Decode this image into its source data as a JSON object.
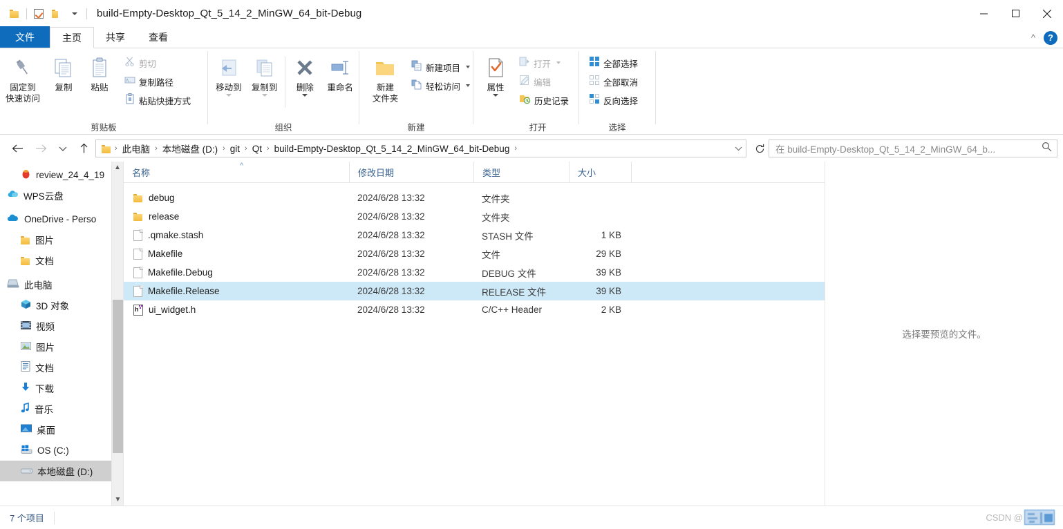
{
  "window": {
    "title": "build-Empty-Desktop_Qt_5_14_2_MinGW_64_bit-Debug",
    "qat": {
      "folder_icon": "folder-icon",
      "properties_icon": "checkbox-properties-icon",
      "new_folder_icon": "new-folder-icon",
      "customize_icon": "chevron-down-icon"
    },
    "controls": {
      "minimize": "minimize-icon",
      "maximize": "maximize-icon",
      "close": "close-icon"
    }
  },
  "tabs": {
    "file": "文件",
    "items": [
      {
        "label": "主页",
        "active": true
      },
      {
        "label": "共享",
        "active": false
      },
      {
        "label": "查看",
        "active": false
      }
    ],
    "collapse_icon": "chevron-up-icon",
    "help_label": "?"
  },
  "ribbon": {
    "groups": [
      {
        "name": "clipboard",
        "label": "剪贴板",
        "big": [
          {
            "label_line1": "固定到",
            "label_line2": "快速访问",
            "icon": "pin-icon",
            "dim": false
          },
          {
            "label_line1": "复制",
            "label_line2": "",
            "icon": "copy-icon",
            "dim": false
          },
          {
            "label_line1": "粘贴",
            "label_line2": "",
            "icon": "paste-icon",
            "dim": false
          }
        ],
        "small": [
          {
            "label": "剪切",
            "icon": "scissors-icon",
            "dim": true
          },
          {
            "label": "复制路径",
            "icon": "copy-path-icon",
            "dim": false
          },
          {
            "label": "粘贴快捷方式",
            "icon": "paste-shortcut-icon",
            "dim": false
          }
        ]
      },
      {
        "name": "organize",
        "label": "组织",
        "big": [
          {
            "label_line1": "移动到",
            "label_line2": "",
            "icon": "move-to-icon",
            "dim": true,
            "caret": true
          },
          {
            "label_line1": "复制到",
            "label_line2": "",
            "icon": "copy-to-icon",
            "dim": true,
            "caret": true
          },
          {
            "label_line1": "删除",
            "label_line2": "",
            "icon": "delete-icon",
            "dim": false,
            "caret": true
          },
          {
            "label_line1": "重命名",
            "label_line2": "",
            "icon": "rename-icon",
            "dim": false
          }
        ],
        "small": []
      },
      {
        "name": "new",
        "label": "新建",
        "big": [
          {
            "label_line1": "新建",
            "label_line2": "文件夹",
            "icon": "new-folder-icon",
            "dim": false
          }
        ],
        "small": [
          {
            "label": "新建项目",
            "icon": "new-item-icon",
            "dim": false,
            "caret": true
          },
          {
            "label": "轻松访问",
            "icon": "easy-access-icon",
            "dim": false,
            "caret": true
          }
        ]
      },
      {
        "name": "open",
        "label": "打开",
        "big": [
          {
            "label_line1": "属性",
            "label_line2": "",
            "icon": "properties-icon",
            "dim": false,
            "caret": true
          }
        ],
        "small": [
          {
            "label": "打开",
            "icon": "open-icon",
            "dim": true,
            "caret": true
          },
          {
            "label": "编辑",
            "icon": "edit-icon",
            "dim": true
          },
          {
            "label": "历史记录",
            "icon": "history-icon",
            "dim": false
          }
        ]
      },
      {
        "name": "select",
        "label": "选择",
        "big": [],
        "small": [
          {
            "label": "全部选择",
            "icon": "select-all-icon",
            "dim": false
          },
          {
            "label": "全部取消",
            "icon": "select-none-icon",
            "dim": false
          },
          {
            "label": "反向选择",
            "icon": "invert-selection-icon",
            "dim": false
          }
        ]
      }
    ]
  },
  "address": {
    "back_icon": "back-arrow-icon",
    "forward_icon": "forward-arrow-icon",
    "recent_icon": "chevron-down-icon",
    "up_icon": "up-arrow-icon",
    "breadcrumbs": [
      "此电脑",
      "本地磁盘 (D:)",
      "git",
      "Qt",
      "build-Empty-Desktop_Qt_5_14_2_MinGW_64_bit-Debug"
    ],
    "dropdown_icon": "chevron-down-icon",
    "refresh_icon": "refresh-icon",
    "search_placeholder": "在 build-Empty-Desktop_Qt_5_14_2_MinGW_64_b...",
    "search_value": "",
    "search_icon": "search-icon"
  },
  "navpane": {
    "items": [
      {
        "label": "review_24_4_19",
        "icon": "recent-red-icon",
        "indent": 1,
        "selected": false
      },
      {
        "label": "WPS云盘",
        "icon": "wps-cloud-icon",
        "indent": 0,
        "selected": false
      },
      {
        "label": "OneDrive - Perso",
        "icon": "onedrive-icon",
        "indent": 0,
        "selected": false
      },
      {
        "label": "图片",
        "icon": "folder-icon",
        "indent": 1,
        "selected": false
      },
      {
        "label": "文档",
        "icon": "folder-icon",
        "indent": 1,
        "selected": false
      },
      {
        "label": "此电脑",
        "icon": "this-pc-icon",
        "indent": 0,
        "selected": false
      },
      {
        "label": "3D 对象",
        "icon": "3d-objects-icon",
        "indent": 1,
        "selected": false
      },
      {
        "label": "视频",
        "icon": "videos-icon",
        "indent": 1,
        "selected": false
      },
      {
        "label": "图片",
        "icon": "pictures-icon",
        "indent": 1,
        "selected": false
      },
      {
        "label": "文档",
        "icon": "documents-icon",
        "indent": 1,
        "selected": false
      },
      {
        "label": "下载",
        "icon": "downloads-icon",
        "indent": 1,
        "selected": false
      },
      {
        "label": "音乐",
        "icon": "music-icon",
        "indent": 1,
        "selected": false
      },
      {
        "label": "桌面",
        "icon": "desktop-icon",
        "indent": 1,
        "selected": false
      },
      {
        "label": "OS (C:)",
        "icon": "windows-drive-icon",
        "indent": 1,
        "selected": false
      },
      {
        "label": "本地磁盘 (D:)",
        "icon": "drive-icon",
        "indent": 1,
        "selected": true
      }
    ],
    "scroll_up_icon": "chevron-up-icon",
    "scroll_down_icon": "chevron-down-icon"
  },
  "filelist": {
    "columns": [
      {
        "label": "名称",
        "sorted": true,
        "sort_dir": "asc"
      },
      {
        "label": "修改日期",
        "sorted": false
      },
      {
        "label": "类型",
        "sorted": false
      },
      {
        "label": "大小",
        "sorted": false
      }
    ],
    "rows": [
      {
        "name": "debug",
        "date": "2024/6/28 13:32",
        "type": "文件夹",
        "size": "",
        "icon": "folder-icon",
        "selected": false
      },
      {
        "name": "release",
        "date": "2024/6/28 13:32",
        "type": "文件夹",
        "size": "",
        "icon": "folder-icon",
        "selected": false
      },
      {
        "name": ".qmake.stash",
        "date": "2024/6/28 13:32",
        "type": "STASH 文件",
        "size": "1 KB",
        "icon": "file-icon",
        "selected": false
      },
      {
        "name": "Makefile",
        "date": "2024/6/28 13:32",
        "type": "文件",
        "size": "29 KB",
        "icon": "file-icon",
        "selected": false
      },
      {
        "name": "Makefile.Debug",
        "date": "2024/6/28 13:32",
        "type": "DEBUG 文件",
        "size": "39 KB",
        "icon": "file-icon",
        "selected": false
      },
      {
        "name": "Makefile.Release",
        "date": "2024/6/28 13:32",
        "type": "RELEASE 文件",
        "size": "39 KB",
        "icon": "file-icon",
        "selected": true
      },
      {
        "name": "ui_widget.h",
        "date": "2024/6/28 13:32",
        "type": "C/C++ Header",
        "size": "2 KB",
        "icon": "header-file-icon",
        "selected": false
      }
    ]
  },
  "preview": {
    "message": "选择要预览的文件。"
  },
  "statusbar": {
    "item_count": "7 个项目"
  },
  "watermark": {
    "text": "CSDN @"
  },
  "colors": {
    "accent": "#0f6cbd",
    "selection": "#cde8f6",
    "nav_selection": "#cfcfcf",
    "column_header_text": "#38618f",
    "status_text": "#2c4f7c",
    "folder_yellow": "#f3bb3d"
  }
}
